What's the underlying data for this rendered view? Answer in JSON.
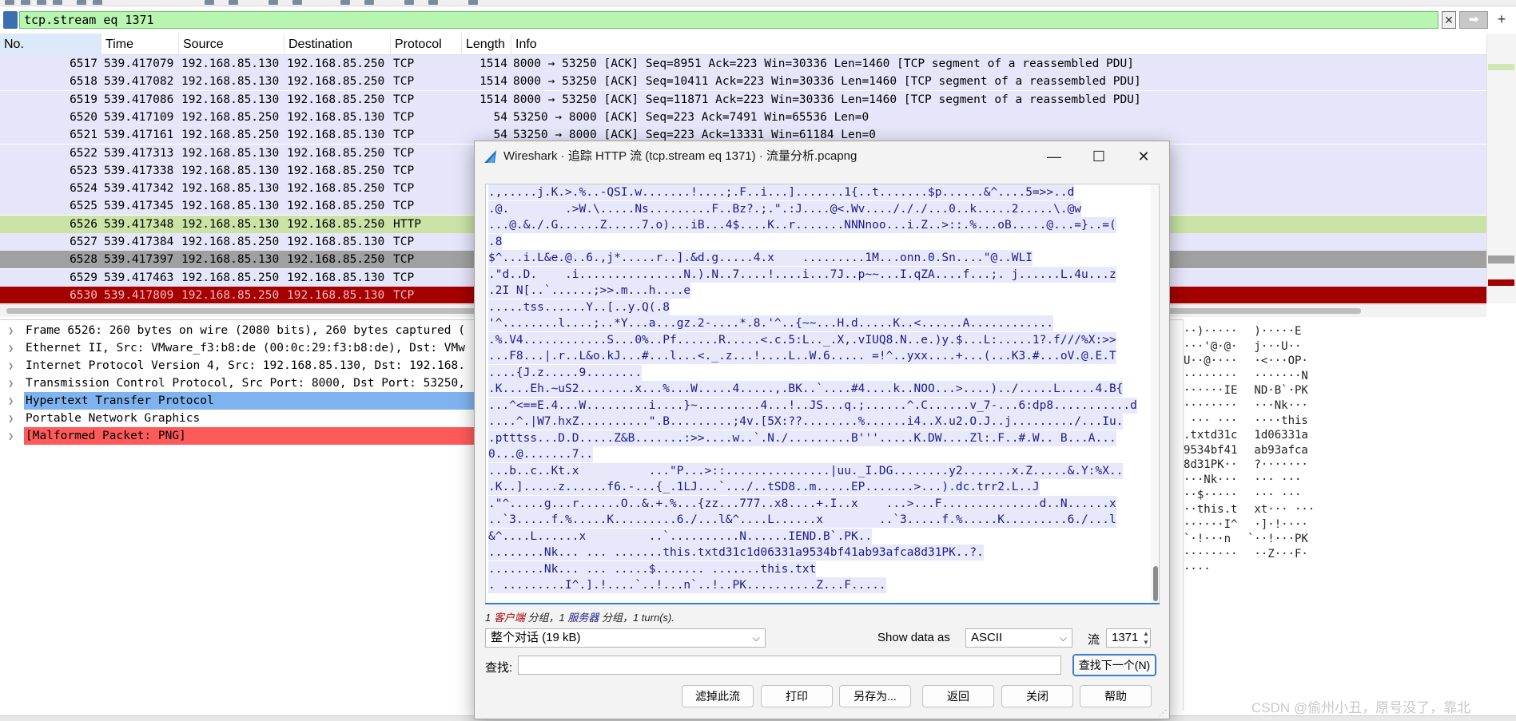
{
  "filter": {
    "value": "tcp.stream eq 1371"
  },
  "columns": [
    "No.",
    "Time",
    "Source",
    "Destination",
    "Protocol",
    "Length",
    "Info"
  ],
  "packets": [
    {
      "no": "6517",
      "time": "539.417079",
      "src": "192.168.85.130",
      "dst": "192.168.85.250",
      "proto": "TCP",
      "len": "1514",
      "info": "8000 → 53250 [ACK] Seq=8951 Ack=223 Win=30336 Len=1460 [TCP segment of a reassembled PDU]"
    },
    {
      "no": "6518",
      "time": "539.417082",
      "src": "192.168.85.130",
      "dst": "192.168.85.250",
      "proto": "TCP",
      "len": "1514",
      "info": "8000 → 53250 [ACK] Seq=10411 Ack=223 Win=30336 Len=1460 [TCP segment of a reassembled PDU]"
    },
    {
      "no": "6519",
      "time": "539.417086",
      "src": "192.168.85.130",
      "dst": "192.168.85.250",
      "proto": "TCP",
      "len": "1514",
      "info": "8000 → 53250 [ACK] Seq=11871 Ack=223 Win=30336 Len=1460 [TCP segment of a reassembled PDU]"
    },
    {
      "no": "6520",
      "time": "539.417109",
      "src": "192.168.85.250",
      "dst": "192.168.85.130",
      "proto": "TCP",
      "len": "54",
      "info": "53250 → 8000 [ACK] Seq=223 Ack=7491 Win=65536 Len=0"
    },
    {
      "no": "6521",
      "time": "539.417161",
      "src": "192.168.85.250",
      "dst": "192.168.85.130",
      "proto": "TCP",
      "len": "54",
      "info": "53250 → 8000 [ACK] Seq=223 Ack=13331 Win=61184 Len=0"
    },
    {
      "no": "6522",
      "time": "539.417313",
      "src": "192.168.85.130",
      "dst": "192.168.85.250",
      "proto": "TCP",
      "len": "",
      "info": ""
    },
    {
      "no": "6523",
      "time": "539.417338",
      "src": "192.168.85.130",
      "dst": "192.168.85.250",
      "proto": "TCP",
      "len": "",
      "info": ""
    },
    {
      "no": "6524",
      "time": "539.417342",
      "src": "192.168.85.130",
      "dst": "192.168.85.250",
      "proto": "TCP",
      "len": "",
      "info": ""
    },
    {
      "no": "6525",
      "time": "539.417345",
      "src": "192.168.85.130",
      "dst": "192.168.85.250",
      "proto": "TCP",
      "len": "",
      "info": ""
    },
    {
      "no": "6526",
      "time": "539.417348",
      "src": "192.168.85.130",
      "dst": "192.168.85.250",
      "proto": "HTTP",
      "len": "",
      "info": ""
    },
    {
      "no": "6527",
      "time": "539.417384",
      "src": "192.168.85.250",
      "dst": "192.168.85.130",
      "proto": "TCP",
      "len": "",
      "info": ""
    },
    {
      "no": "6528",
      "time": "539.417397",
      "src": "192.168.85.130",
      "dst": "192.168.85.250",
      "proto": "TCP",
      "len": "",
      "info": ""
    },
    {
      "no": "6529",
      "time": "539.417463",
      "src": "192.168.85.250",
      "dst": "192.168.85.130",
      "proto": "TCP",
      "len": "",
      "info": ""
    },
    {
      "no": "6530",
      "time": "539.417809",
      "src": "192.168.85.250",
      "dst": "192.168.85.130",
      "proto": "TCP",
      "len": "",
      "info": ""
    }
  ],
  "details": [
    "Frame 6526: 260 bytes on wire (2080 bits), 260 bytes captured (",
    "Ethernet II, Src: VMware_f3:b8:de (00:0c:29:f3:b8:de), Dst: VMw",
    "Internet Protocol Version 4, Src: 192.168.85.130, Dst: 192.168.",
    "Transmission Control Protocol, Src Port: 8000, Dst Port: 53250,",
    "Hypertext Transfer Protocol",
    "Portable Network Graphics",
    "[Malformed Packet: PNG]"
  ],
  "bytes": [
    [
      "··)·····",
      " )·····E"
    ],
    [
      "···'@·@·",
      " j···U··"
    ],
    [
      "U··@····",
      " ·<···OP·"
    ],
    [
      "········",
      " ·······N"
    ],
    [
      "······IE",
      " ND·B`·PK"
    ],
    [
      "········",
      " ···Nk···"
    ],
    [
      " ··· ···",
      " ····this"
    ],
    [
      ".txtd31c",
      " 1d06331a"
    ],
    [
      "9534bf41",
      " ab93afca"
    ],
    [
      "8d31PK··",
      " ?·······"
    ],
    [
      "···Nk···",
      " ··· ···"
    ],
    [
      "··$·····",
      " ··· ···"
    ],
    [
      "··this.t",
      " xt··· ···"
    ],
    [
      "······I^",
      " ·]·!····"
    ],
    [
      "`·!···n ",
      "`··!···PK"
    ],
    [
      "········",
      " ··Z···F·"
    ],
    [
      "····",
      ""
    ]
  ],
  "dialog": {
    "title": "Wireshark · 追踪 HTTP 流 (tcp.stream eq 1371) · 流量分析.pcapng",
    "stream_lines": [
      ".,.....j.K.>.%..-QSI.w.......!....;.F..i...].......1{..t.......$p......&^....5=>>..d",
      ".@.        .>W.\\.....Ns.........F..Bz?.;.\".:J....@<.Wv..../././...0..k.....2.....\\.@w",
      "...@.&./.G......Z.....7.o)...iB...4$....K..r.......NNNnoo...i.Z..>::.%...oB.....@...=}..=(",
      ".8",
      "$^...i.L&e.@..6.,j*.....r..].&d.g.....4.x    .........1M...onn.0.Sn....\"@..WLI",
      ".\"d..D.    .i...............N.).N..7....!....i...7J..p~~...I.qZA....f...;. j......L.4u...z",
      ".2I N[..`......;>>.m...h....e",
      ".....tss......Y..[..y.Q(.8",
      "'^........l....;..*Y...a...gz.2-....*.8.'^..{~~...H.d.....K..<......A............",
      ".%.V4............S...0%..Pf......R.....<.c.5:L.._.X,.vIUQ8.N..e.)y.$...L:.....1?.f///%X:>>",
      "...F8...|.r..L&o.kJ...#...l...<._.z...!....L..W.6..... =!^..yxx....+...(...K3.#...oV.@.E.T",
      "....{J.z.....9........",
      ".K....Eh.~uS2........x...%...W.....4.....,.BK..`....#4....k..NOO...>....)../.....L.....4.B{",
      "...^<==E.4...W.........i....}~.........4...!..JS...q.;......^.C......v_7-...6:dp8...........d",
      "....^.|W7.hxZ..........\".B.........;4v.[5X:??........%......i4..X.u2.O.J..j........./...Iu.",
      ".ptttss...D.D.....Z&B.......:>>....w..`.N./.........B'''.....K.DW....Zl:.F..#.W.. B...A...",
      "0...@.......7..",
      "...b..c..Kt.x          ...\"P...>::...............|uu._I.DG........y2.......x.Z.....&.Y:%X..",
      ".K..].....z......f6.-...{_.1LJ...`.../..tSD8..m.....EP.......>...).dc.trr2.L..J",
      ".\"^.....g...r......O..&.+.%...{zz...777..x8....+.I..x    ...>...F..............d..N......x",
      "..`3.....f.%.....K.........6./...l&^....L......x        ..`3.....f.%.....K.........6./...l",
      "&^....L......x         ..`..........N......IEND.B`.PK..",
      "........Nk... ... .......this.txtd31c1d06331a9534bf41ab93afca8d31PK..?.",
      "........Nk... ... .....$....... .......this.txt",
      ". .........I^.].!....`..!...n`..!..PK..........Z...F....."
    ],
    "summary_prefix": "1 ",
    "summary_client": "客户端",
    "summary_mid": " 分组，1 ",
    "summary_server": "服务器",
    "summary_suffix": " 分组，1 turn(s).",
    "conversation": "整个对话 (19 kB)",
    "show_data_as_label": "Show data as",
    "format": "ASCII",
    "stream_label": "流",
    "stream_number": "1371",
    "find_label": "查找:",
    "find_next": "查找下一个(N)",
    "buttons": {
      "filter_out": "滤掉此流",
      "print": "打印",
      "save_as": "另存为...",
      "back": "返回",
      "close": "关闭",
      "help": "帮助"
    }
  },
  "watermark": "CSDN @偷州小丑，原号没了，靠北",
  "colors": {
    "tcp_row": "#e6e6fa",
    "http_row": "#cbe3a6",
    "gray_row": "#a0a0a0",
    "error_row": "#a40000",
    "filter_ok": "#b8f5b0",
    "selected_detail": "#7fb3ef",
    "malformed": "#ff5a5a"
  }
}
